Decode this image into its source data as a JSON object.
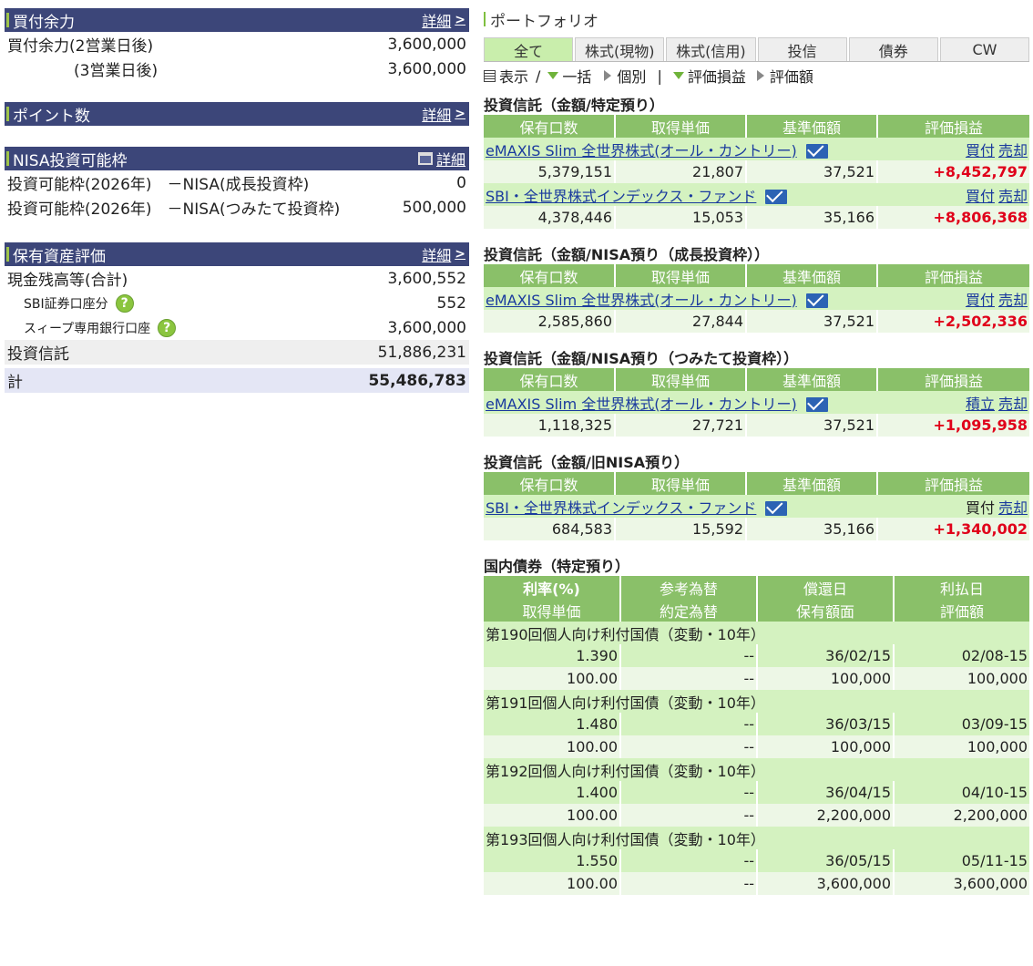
{
  "left": {
    "buying_power": {
      "title": "買付余力",
      "detail": "詳細",
      "rows": [
        {
          "label": "買付余力(2営業日後)",
          "value": "3,600,000"
        },
        {
          "label": "(3営業日後)",
          "value": "3,600,000"
        }
      ]
    },
    "points": {
      "title": "ポイント数",
      "detail": "詳細"
    },
    "nisa": {
      "title": "NISA投資可能枠",
      "detail": "詳細",
      "rows": [
        {
          "label": "投資可能枠(2026年)　－NISA(成長投資枠)",
          "value": "0"
        },
        {
          "label": "投資可能枠(2026年)　－NISA(つみたて投資枠)",
          "value": "500,000"
        }
      ]
    },
    "assets": {
      "title": "保有資産評価",
      "detail": "詳細",
      "cash_label": "現金残高等(合計)",
      "cash_value": "3,600,552",
      "sbi_label": "SBI証券口座分",
      "sbi_value": "552",
      "sweep_label": "スィープ専用銀行口座",
      "sweep_value": "3,600,000",
      "fund_label": "投資信託",
      "fund_value": "51,886,231",
      "total_label": "計",
      "total_value": "55,486,783"
    }
  },
  "portfolio": {
    "title": "ポートフォリオ",
    "tabs": [
      "全て",
      "株式(現物)",
      "株式(信用)",
      "投信",
      "債券",
      "CW"
    ],
    "view": {
      "display": "表示",
      "sep": "/",
      "bulk": "一括",
      "individual": "個別",
      "bar": "|",
      "gain": "評価損益",
      "amount": "評価額"
    },
    "fund_headers": [
      "保有口数",
      "取得単価",
      "基準価額",
      "評価損益"
    ],
    "sections": [
      {
        "title": "投資信託（金額/特定預り）",
        "funds": [
          {
            "name": "eMAXIS Slim 全世界株式(オール・カントリー)",
            "link1": "買付",
            "link2": "売却",
            "units": "5,379,151",
            "cost": "21,807",
            "nav": "37,521",
            "pl": "+8,452,797"
          },
          {
            "name": "SBI・全世界株式インデックス・ファンド",
            "link1": "買付",
            "link2": "売却",
            "units": "4,378,446",
            "cost": "15,053",
            "nav": "35,166",
            "pl": "+8,806,368"
          }
        ]
      },
      {
        "title": "投資信託（金額/NISA預り（成長投資枠））",
        "funds": [
          {
            "name": "eMAXIS Slim 全世界株式(オール・カントリー)",
            "link1": "買付",
            "link2": "売却",
            "units": "2,585,860",
            "cost": "27,844",
            "nav": "37,521",
            "pl": "+2,502,336"
          }
        ]
      },
      {
        "title": "投資信託（金額/NISA預り（つみたて投資枠））",
        "funds": [
          {
            "name": "eMAXIS Slim 全世界株式(オール・カントリー)",
            "link1": "積立",
            "link2": "売却",
            "units": "1,118,325",
            "cost": "27,721",
            "nav": "37,521",
            "pl": "+1,095,958"
          }
        ]
      },
      {
        "title": "投資信託（金額/旧NISA預り）",
        "funds": [
          {
            "name": "SBI・全世界株式インデックス・ファンド",
            "link1": "買付",
            "link2": "売却",
            "units": "684,583",
            "cost": "15,592",
            "nav": "35,166",
            "pl": "+1,340,002"
          }
        ]
      }
    ],
    "bonds": {
      "title": "国内債券（特定預り）",
      "headers1": [
        "利率(%)",
        "参考為替",
        "償還日",
        "利払日"
      ],
      "headers2": [
        "取得単価",
        "約定為替",
        "保有額面",
        "評価額"
      ],
      "items": [
        {
          "name": "第190回個人向け利付国債（変動・10年）",
          "rate": "1.390",
          "fx": "--",
          "maturity": "36/02/15",
          "pay": "02/08-15",
          "cost": "100.00",
          "fx2": "--",
          "face": "100,000",
          "value": "100,000"
        },
        {
          "name": "第191回個人向け利付国債（変動・10年）",
          "rate": "1.480",
          "fx": "--",
          "maturity": "36/03/15",
          "pay": "03/09-15",
          "cost": "100.00",
          "fx2": "--",
          "face": "100,000",
          "value": "100,000"
        },
        {
          "name": "第192回個人向け利付国債（変動・10年）",
          "rate": "1.400",
          "fx": "--",
          "maturity": "36/04/15",
          "pay": "04/10-15",
          "cost": "100.00",
          "fx2": "--",
          "face": "2,200,000",
          "value": "2,200,000"
        },
        {
          "name": "第193回個人向け利付国債（変動・10年）",
          "rate": "1.550",
          "fx": "--",
          "maturity": "36/05/15",
          "pay": "05/11-15",
          "cost": "100.00",
          "fx2": "--",
          "face": "3,600,000",
          "value": "3,600,000"
        }
      ]
    }
  }
}
